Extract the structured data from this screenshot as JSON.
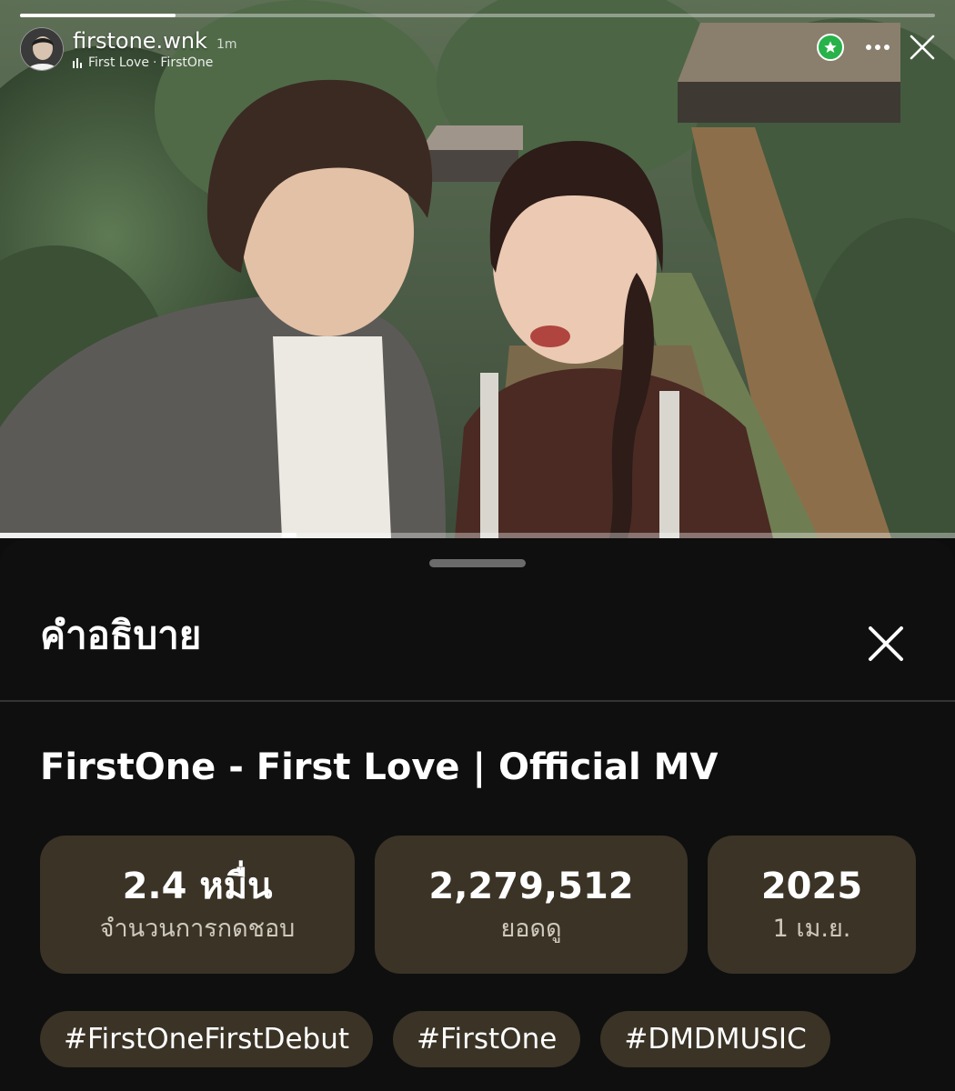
{
  "story": {
    "username": "firstone.wnk",
    "time_ago": "1m",
    "music_title": "First Love",
    "music_artist": "FirstOne",
    "progress": 0.17,
    "video_progress": 0.31
  },
  "sheet": {
    "title": "คำอธิบาย",
    "video_title": "FirstOne - First Love | Official MV",
    "stats": [
      {
        "value": "2.4 หมื่น",
        "label": "จำนวนการกดชอบ"
      },
      {
        "value": "2,279,512",
        "label": "ยอดดู"
      },
      {
        "value": "2025",
        "label": "1 เม.ย."
      }
    ],
    "hashtags": [
      "#FirstOneFirstDebut",
      "#FirstOne",
      "#DMDMUSIC"
    ]
  },
  "colors": {
    "sheet_bg": "#0f0f0f",
    "chip_bg": "#3a3326",
    "close_friends_green": "#27b24a"
  },
  "icons": {
    "close_friends": "star-icon",
    "more": "more-icon",
    "close": "close-icon"
  }
}
